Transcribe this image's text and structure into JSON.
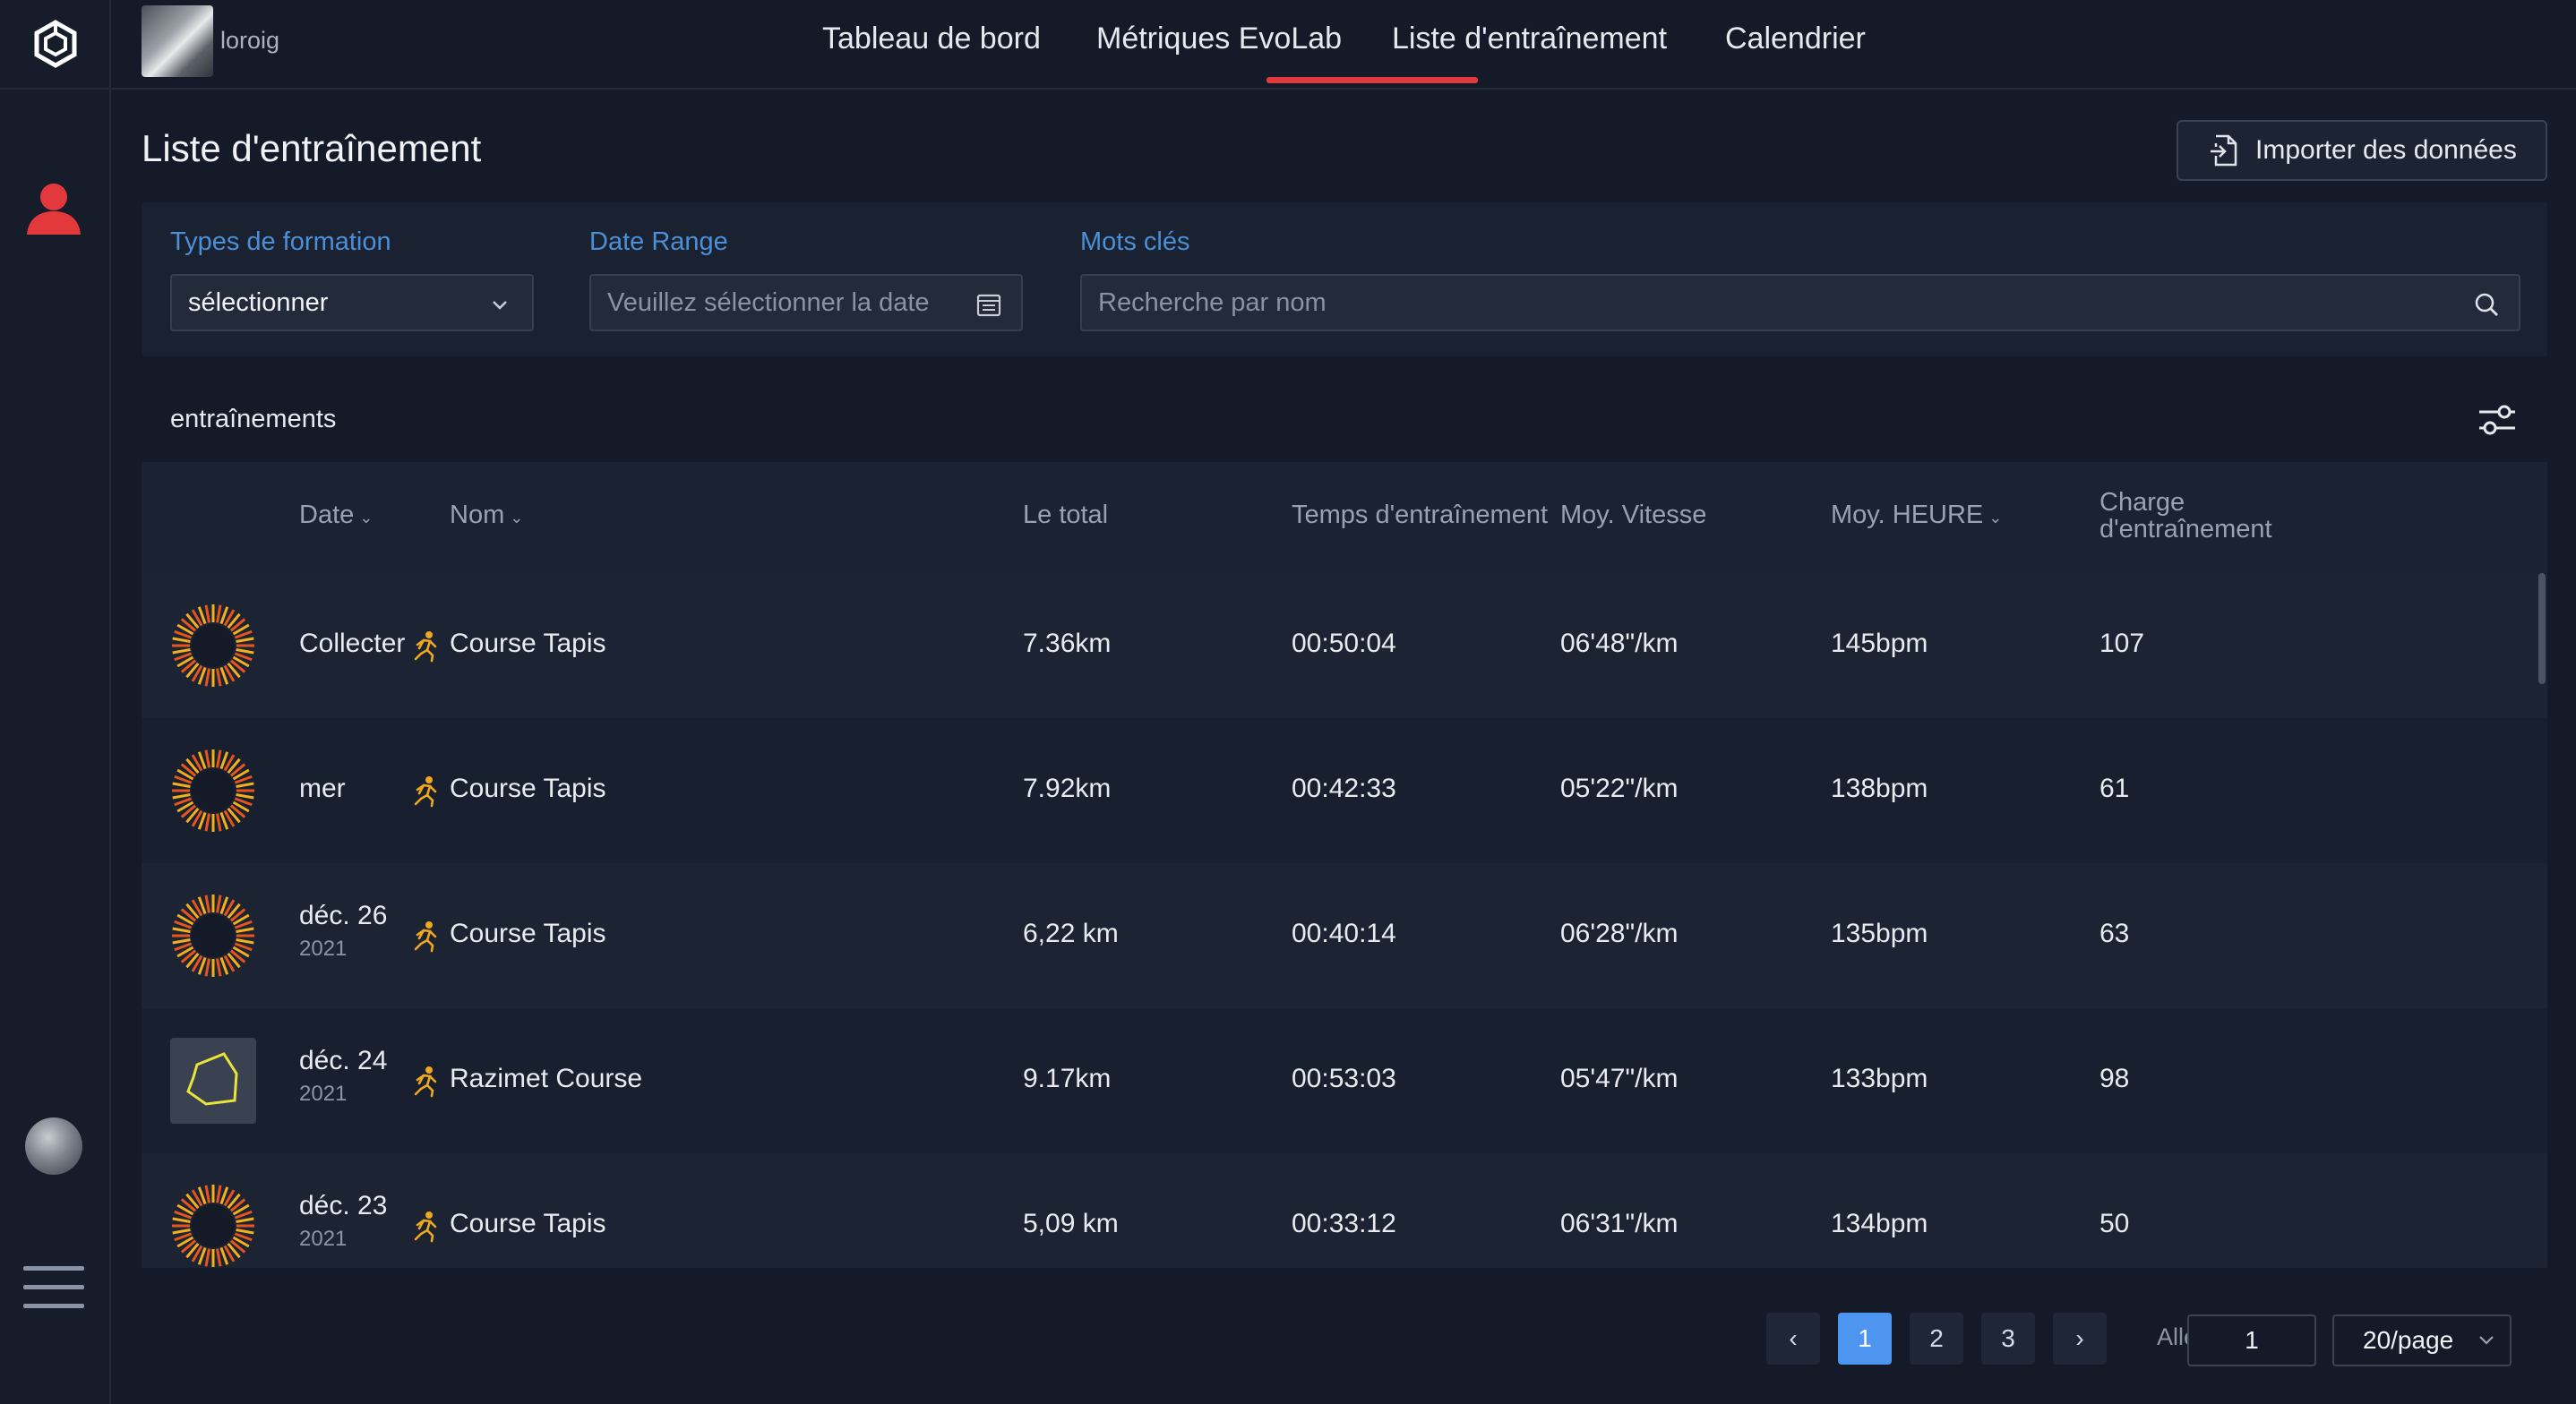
{
  "app": {
    "username": "loroig",
    "nav": [
      {
        "label": "Tableau de bord",
        "active": false
      },
      {
        "label": "Métriques EvoLab",
        "active": false
      },
      {
        "label": "Liste d'entraînement",
        "active": true
      },
      {
        "label": "Calendrier",
        "active": false
      }
    ],
    "accent_color": "#e4393c",
    "link_color": "#4b8fd6"
  },
  "page": {
    "title": "Liste d'entraînement",
    "import_button": "Importer des données"
  },
  "filters": {
    "type_label": "Types de formation",
    "type_value": "sélectionner",
    "date_label": "Date Range",
    "date_placeholder": "Veuillez sélectionner la date",
    "keyword_label": "Mots clés",
    "keyword_placeholder": "Recherche par nom"
  },
  "list": {
    "section_title": "entraînements",
    "columns": {
      "date": "Date",
      "name": "Nom",
      "total": "Le total",
      "time": "Temps d'entraînement",
      "speed": "Moy. Vitesse",
      "hr": "Moy. HEURE",
      "load_line1": "Charge",
      "load_line2": "d'entraînement"
    },
    "rows": [
      {
        "thumb": "treadmill-sunburst-icon",
        "date": "Collecter",
        "year": "",
        "sport_icon": "running-icon",
        "name": "Course Tapis",
        "total": "7.36km",
        "time": "00:50:04",
        "speed": "06'48\"/km",
        "hr": "145bpm",
        "load": "107"
      },
      {
        "thumb": "treadmill-sunburst-icon",
        "date": "mer",
        "year": "",
        "sport_icon": "running-icon",
        "name": "Course Tapis",
        "total": "7.92km",
        "time": "00:42:33",
        "speed": "05'22\"/km",
        "hr": "138bpm",
        "load": "61"
      },
      {
        "thumb": "treadmill-sunburst-icon",
        "date": "déc. 26",
        "year": "2021",
        "sport_icon": "running-icon",
        "name": "Course Tapis",
        "total": "6,22 km",
        "time": "00:40:14",
        "speed": "06'28\"/km",
        "hr": "135bpm",
        "load": "63"
      },
      {
        "thumb": "route-map-icon",
        "date": "déc. 24",
        "year": "2021",
        "sport_icon": "outdoor-run-icon",
        "name": "Razimet Course",
        "total": "9.17km",
        "time": "00:53:03",
        "speed": "05'47\"/km",
        "hr": "133bpm",
        "load": "98"
      },
      {
        "thumb": "treadmill-sunburst-icon",
        "date": "déc. 23",
        "year": "2021",
        "sport_icon": "running-icon",
        "name": "Course Tapis",
        "total": "5,09 km",
        "time": "00:33:12",
        "speed": "06'31\"/km",
        "hr": "134bpm",
        "load": "50"
      }
    ]
  },
  "pagination": {
    "prev": "‹",
    "pages": [
      "1",
      "2",
      "3"
    ],
    "active_page": "1",
    "next": "›",
    "goto_label": "Aller à",
    "goto_value": "1",
    "page_size": "20/page"
  }
}
